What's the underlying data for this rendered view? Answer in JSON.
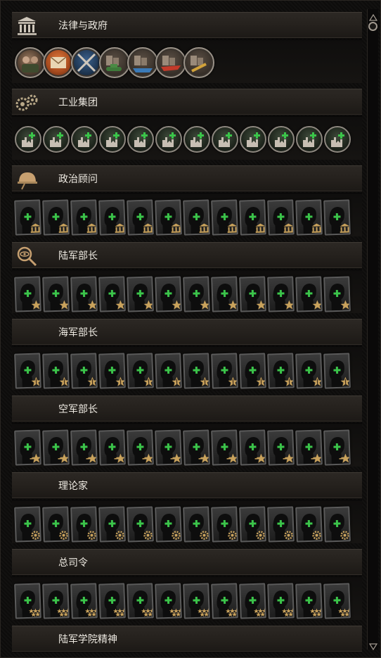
{
  "sections": [
    {
      "key": "laws",
      "label": "法律与政府",
      "icon": "government-building-icon"
    },
    {
      "key": "industrial",
      "label": "工业集团",
      "icon": "gears-icon"
    },
    {
      "key": "political",
      "label": "政治顾问",
      "icon": "helmet-icon"
    },
    {
      "key": "army_chief",
      "label": "陆军部长",
      "icon": "magnifier-eye-icon"
    },
    {
      "key": "navy_chief",
      "label": "海军部长",
      "icon": ""
    },
    {
      "key": "air_chief",
      "label": "空军部长",
      "icon": ""
    },
    {
      "key": "theorist",
      "label": "理论家",
      "icon": ""
    },
    {
      "key": "high_command",
      "label": "总司令",
      "icon": ""
    },
    {
      "key": "army_spirit",
      "label": "陆军学院精神",
      "icon": ""
    }
  ],
  "laws_icons": [
    "conscription-law-icon",
    "trade-law-icon",
    "economy-law-icon",
    "tank-designer-icon",
    "naval-designer-icon",
    "aircraft-designer-icon",
    "materiel-designer-icon"
  ],
  "industrial_slots": 12,
  "advisor_slots": 12,
  "colors": {
    "accent_green": "#3bc44a",
    "gold": "#c9a25c",
    "header_text": "#eeeae2"
  }
}
